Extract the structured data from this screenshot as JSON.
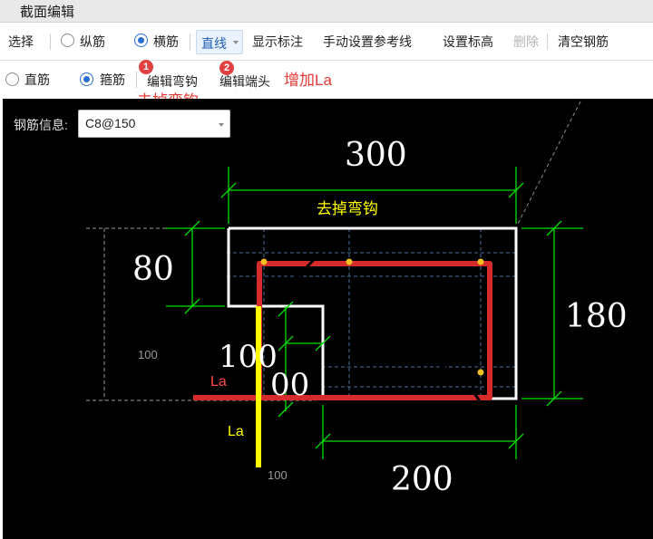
{
  "window": {
    "title": "截面编辑"
  },
  "toolbar1": {
    "select": "选择",
    "longitudinal": "纵筋",
    "transverse": "横筋",
    "line_type": "直线",
    "show_dims": "显示标注",
    "manual_ref": "手动设置参考线",
    "set_elev": "设置标高",
    "delete": "删除",
    "clear": "清空钢筋"
  },
  "toolbar2": {
    "straight": "直筋",
    "stirrup": "箍筋",
    "edit_hook": "编辑弯钩",
    "edit_end": "编辑端头",
    "badge1": "1",
    "badge2": "2",
    "note_remove_hook": "去掉弯钩",
    "note_add_la": "增加La"
  },
  "rebar_info": {
    "label": "钢筋信息:",
    "value": "C8@150"
  },
  "drawing": {
    "dim_top": "300",
    "dim_left": "80",
    "dim_right": "180",
    "dim_bottom": "200",
    "dim_mid_a": "100",
    "dim_mid_b": "00",
    "dim_small_left": "100",
    "dim_small_bottom": "100",
    "note_yellow": "去掉弯钩",
    "la_red": "La",
    "la_yellow": "La"
  },
  "colors": {
    "canvas_bg": "#000000",
    "dim_green": "#00e000",
    "outline_white": "#ffffff",
    "rebar_red": "#e03030",
    "la_yellow": "#ffff00",
    "accent_blue": "#2a6fd0",
    "annotation_red": "#e53935"
  }
}
